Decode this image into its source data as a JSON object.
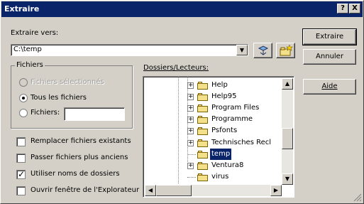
{
  "window": {
    "title": "Extraire",
    "help_button": "?",
    "close_button": "X"
  },
  "extract_to": {
    "label": "Extraire vers:",
    "path": "C:\\temp"
  },
  "files_group": {
    "title": "Fichiers",
    "selected_files": "Fichiers sélectionnés",
    "all_files": "Tous les fichiers",
    "files": "Fichiers:",
    "files_value": ""
  },
  "options": {
    "replace_existing": "Remplacer fichiers existants",
    "skip_older": "Passer fichiers plus anciens",
    "use_folder_names": "Utiliser noms de dossiers",
    "open_explorer": "Ouvrir fenêtre de l'Explorateur"
  },
  "folders": {
    "label": "Dossiers/Lecteurs:",
    "items": [
      "Help",
      "Help95",
      "Program Files",
      "Programme",
      "Psfonts",
      "Technisches Recl",
      "temp",
      "Ventura8",
      "virus"
    ]
  },
  "buttons": {
    "extract": "Extraire",
    "cancel": "Annuler",
    "help": "Aide"
  }
}
